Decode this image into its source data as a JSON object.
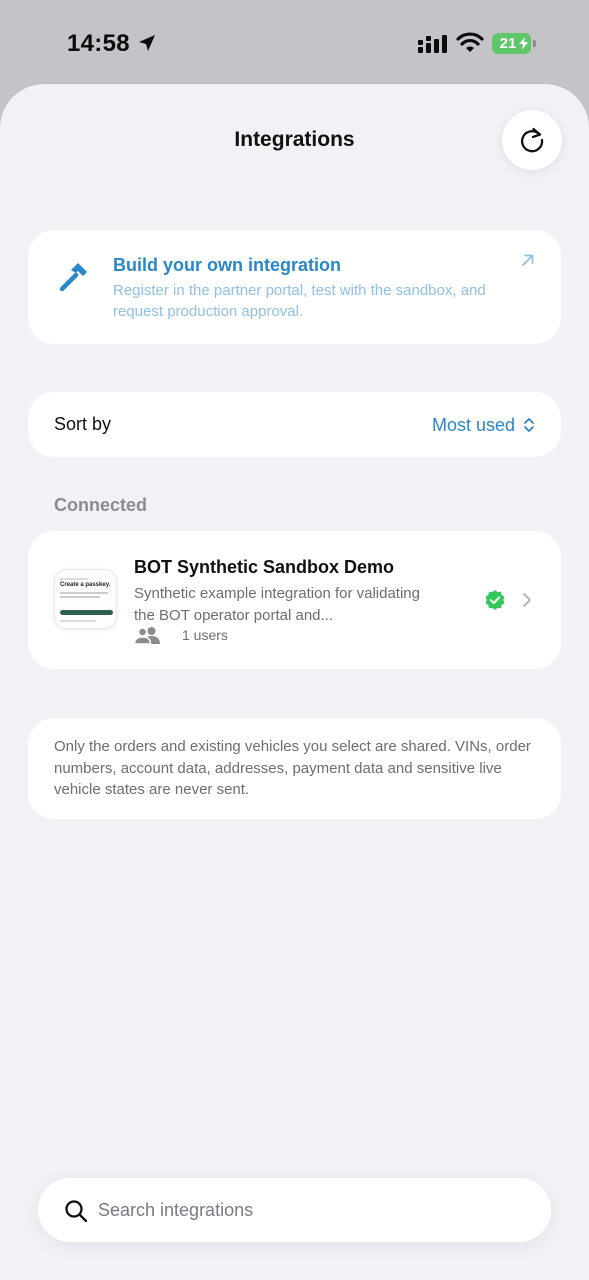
{
  "status_bar": {
    "time": "14:58",
    "battery": "21"
  },
  "header": {
    "title": "Integrations"
  },
  "build_card": {
    "title": "Build your own integration",
    "description": "Register in the partner portal, test with the sandbox, and request production approval."
  },
  "sort": {
    "label": "Sort by",
    "value": "Most used"
  },
  "connected": {
    "section_label": "Connected",
    "items": [
      {
        "name": "BOT Synthetic Sandbox Demo",
        "description": "Synthetic example integration for validating the BOT operator portal and...",
        "users": "1 users",
        "thumbnail_title": "Create a passkey."
      }
    ]
  },
  "notice": {
    "text": "Only the orders and existing vehicles you select are shared. VINs, order numbers, account data, addresses, payment data and sensitive live vehicle states are never sent."
  },
  "search": {
    "placeholder": "Search integrations"
  },
  "colors": {
    "accent": "#2a86c9",
    "verified": "#34c759",
    "background": "#f1f1f6"
  }
}
